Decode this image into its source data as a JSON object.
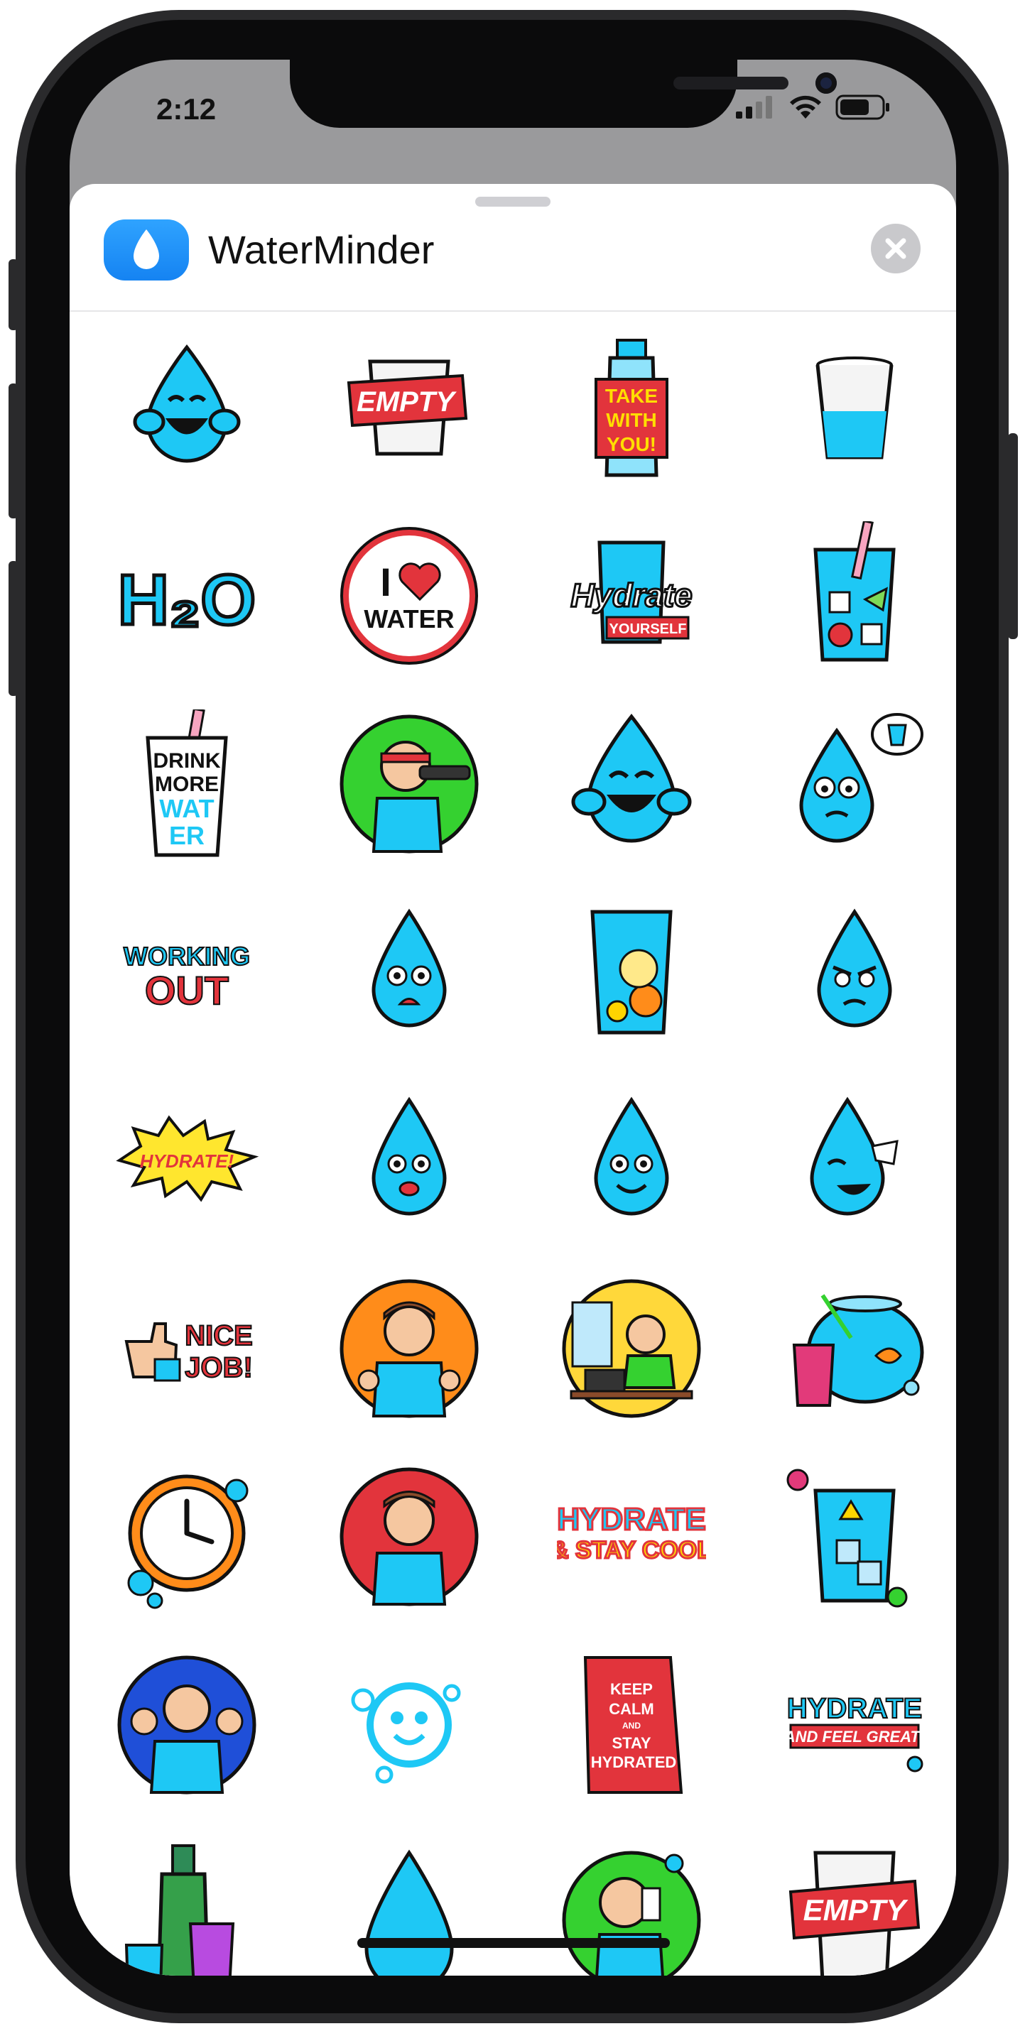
{
  "status_bar": {
    "time": "2:12"
  },
  "sheet": {
    "app_name": "WaterMinder"
  },
  "colors": {
    "water_blue": "#1ec8f5",
    "outline": "#111111",
    "red": "#e2343c",
    "accent_blue": "#1583f2"
  },
  "stickers": {
    "empty": "EMPTY",
    "take1": "TAKE",
    "take2": "WITH",
    "take3": "YOU!",
    "h2o": "H₂O",
    "i": "I",
    "water": "WATER",
    "hydrate": "Hydrate",
    "yourself": "YOURSELF",
    "drink1": "DRINK",
    "drink2": "MORE",
    "drink3": "WAT",
    "drink4": "ER",
    "working": "WORKING",
    "out": "OUT",
    "hydrate_burst": "HYDRATE!",
    "nice": "NICE",
    "job": "JOB!",
    "hydrate_cool1": "HYDRATE",
    "hydrate_cool2": "& STAY COOL",
    "keep1": "KEEP",
    "keep2": "CALM",
    "keep3": "AND",
    "keep4": "STAY",
    "keep5": "HYDRATED",
    "feel1": "HYDRATE",
    "feel2": "AND FEEL GREAT!",
    "empty2": "EMPTY"
  }
}
